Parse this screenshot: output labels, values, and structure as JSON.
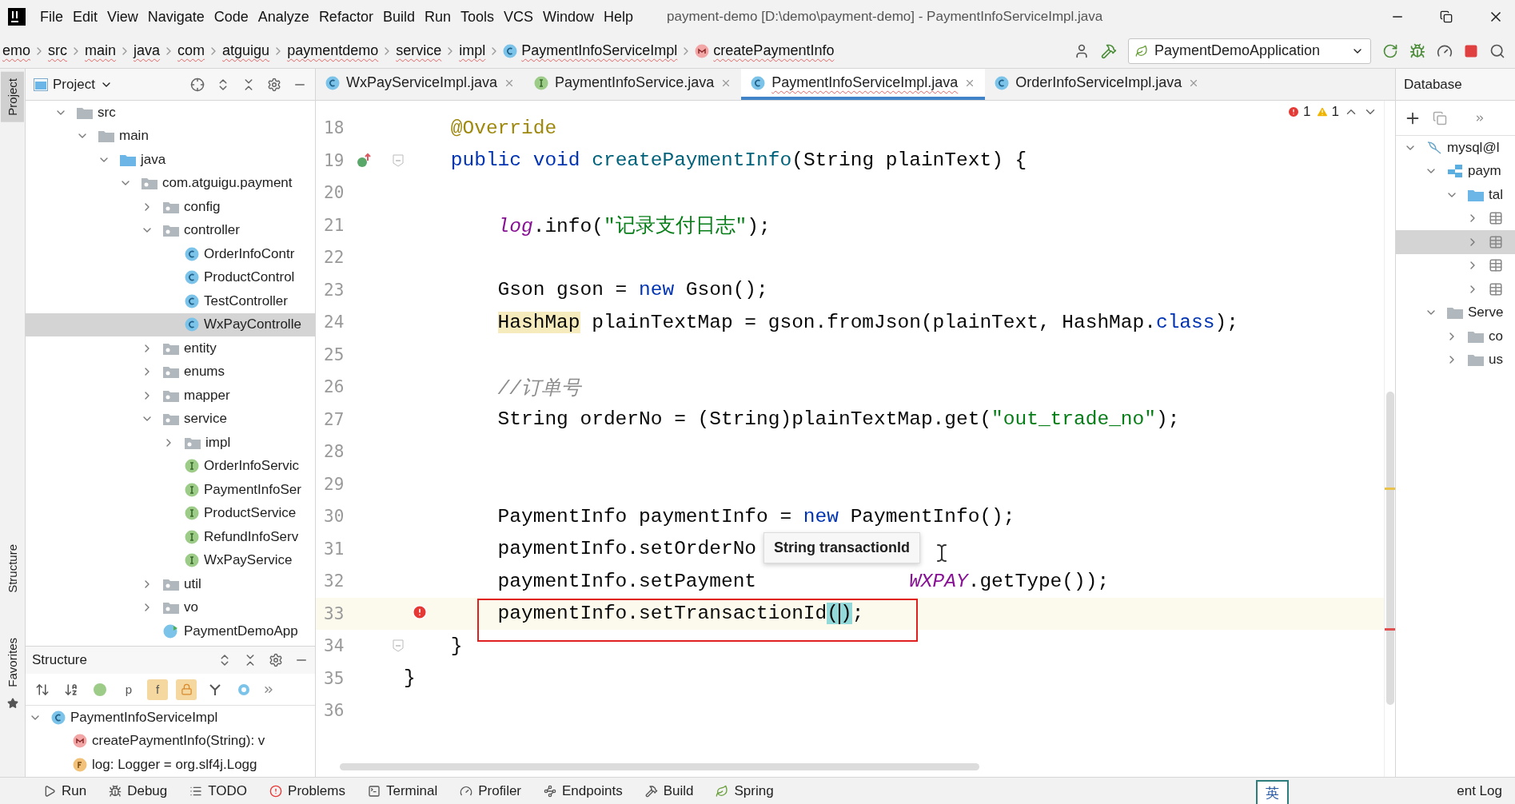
{
  "menu_bar": {
    "items": [
      "File",
      "Edit",
      "View",
      "Navigate",
      "Code",
      "Analyze",
      "Refactor",
      "Build",
      "Run",
      "Tools",
      "VCS",
      "Window",
      "Help"
    ],
    "title": "payment-demo [D:\\demo\\payment-demo] - PaymentInfoServiceImpl.java"
  },
  "navigation_bar": {
    "breadcrumbs": [
      {
        "label": "emo",
        "kind": "text"
      },
      {
        "label": "src",
        "kind": "text"
      },
      {
        "label": "main",
        "kind": "text"
      },
      {
        "label": "java",
        "kind": "text"
      },
      {
        "label": "com",
        "kind": "text"
      },
      {
        "label": "atguigu",
        "kind": "text"
      },
      {
        "label": "paymentdemo",
        "kind": "text"
      },
      {
        "label": "service",
        "kind": "text"
      },
      {
        "label": "impl",
        "kind": "text"
      },
      {
        "label": "PaymentInfoServiceImpl",
        "kind": "class"
      },
      {
        "label": "createPaymentInfo",
        "kind": "method"
      }
    ],
    "run_configuration": "PaymentDemoApplication"
  },
  "side_stripe": [
    {
      "label": "Project",
      "selected": true
    },
    {
      "label": "Structure",
      "selected": false
    },
    {
      "label": "Favorites",
      "selected": false
    }
  ],
  "project_panel": {
    "title": "Project",
    "tree": [
      {
        "label": "src",
        "kind": "folder",
        "expanded": true,
        "selected": false,
        "children": [
          {
            "label": "main",
            "kind": "folder",
            "expanded": true,
            "selected": false,
            "children": [
              {
                "label": "java",
                "kind": "source",
                "expanded": true,
                "selected": false,
                "children": [
                  {
                    "label": "com.atguigu.payment",
                    "kind": "package",
                    "expanded": true,
                    "selected": false,
                    "children": [
                      {
                        "label": "config",
                        "kind": "package",
                        "expanded": false,
                        "selected": false
                      },
                      {
                        "label": "controller",
                        "kind": "package",
                        "expanded": true,
                        "selected": false,
                        "children": [
                          {
                            "label": "OrderInfoContr",
                            "kind": "class",
                            "selected": false
                          },
                          {
                            "label": "ProductControl",
                            "kind": "class",
                            "selected": false
                          },
                          {
                            "label": "TestController",
                            "kind": "class",
                            "selected": false
                          },
                          {
                            "label": "WxPayControlle",
                            "kind": "class",
                            "selected": true
                          }
                        ]
                      },
                      {
                        "label": "entity",
                        "kind": "package",
                        "expanded": false,
                        "selected": false
                      },
                      {
                        "label": "enums",
                        "kind": "package",
                        "expanded": false,
                        "selected": false
                      },
                      {
                        "label": "mapper",
                        "kind": "package",
                        "expanded": false,
                        "selected": false
                      },
                      {
                        "label": "service",
                        "kind": "package",
                        "expanded": true,
                        "selected": false,
                        "children": [
                          {
                            "label": "impl",
                            "kind": "package",
                            "expanded": false,
                            "selected": false
                          },
                          {
                            "label": "OrderInfoServic",
                            "kind": "interface",
                            "selected": false
                          },
                          {
                            "label": "PaymentInfoSer",
                            "kind": "interface",
                            "selected": false
                          },
                          {
                            "label": "ProductService",
                            "kind": "interface",
                            "selected": false
                          },
                          {
                            "label": "RefundInfoServ",
                            "kind": "interface",
                            "selected": false
                          },
                          {
                            "label": "WxPayService",
                            "kind": "interface",
                            "selected": false
                          }
                        ]
                      },
                      {
                        "label": "util",
                        "kind": "package",
                        "expanded": false,
                        "selected": false
                      },
                      {
                        "label": "vo",
                        "kind": "package",
                        "expanded": false,
                        "selected": false
                      },
                      {
                        "label": "PaymentDemoApp",
                        "kind": "app",
                        "selected": false
                      }
                    ]
                  }
                ]
              }
            ]
          }
        ]
      }
    ]
  },
  "editor_tabs": [
    {
      "label": "WxPayServiceImpl.java",
      "kind": "class",
      "selected": false
    },
    {
      "label": "PaymentInfoService.java",
      "kind": "interface",
      "selected": false
    },
    {
      "label": "PaymentInfoServiceImpl.java",
      "kind": "class",
      "selected": true
    },
    {
      "label": "OrderInfoServiceImpl.java",
      "kind": "class",
      "selected": false
    }
  ],
  "editor": {
    "inspections": {
      "errors": "1",
      "warnings": "1"
    },
    "tooltip": "String transactionId",
    "blocks": [
      {
        "kind": "member",
        "lines": [
          {
            "number": "18",
            "kind": "plain",
            "fold": false,
            "current": false,
            "segments": [
              {
                "kind": "annotation",
                "text": "@Override"
              }
            ]
          },
          {
            "number": "19",
            "kind": "override",
            "fold": true,
            "current": false,
            "segments": [
              {
                "kind": "keyword",
                "text": "public void "
              },
              {
                "kind": "method",
                "text": "createPaymentInfo"
              },
              {
                "kind": "plain",
                "text": "(String plainText) {"
              }
            ]
          }
        ]
      },
      {
        "kind": "body",
        "lines": [
          {
            "number": "20",
            "kind": "plain",
            "fold": false,
            "current": false
          },
          {
            "number": "21",
            "kind": "plain",
            "fold": false,
            "current": false,
            "segments": [
              {
                "kind": "field",
                "text": "log"
              },
              {
                "kind": "plain",
                "text": ".info("
              },
              {
                "kind": "string",
                "text": "\"记录支付日志\""
              },
              {
                "kind": "plain",
                "text": ");"
              }
            ]
          },
          {
            "number": "22",
            "kind": "plain",
            "fold": false,
            "current": false
          },
          {
            "number": "23",
            "kind": "plain",
            "fold": false,
            "current": false,
            "segments": [
              {
                "kind": "plain",
                "text": "Gson gson = "
              },
              {
                "kind": "keyword",
                "text": "new"
              },
              {
                "kind": "plain",
                "text": " Gson();"
              }
            ]
          },
          {
            "number": "24",
            "kind": "plain",
            "fold": false,
            "current": false,
            "segments": [
              {
                "kind": "warning",
                "text": "HashMap"
              },
              {
                "kind": "plain",
                "text": " plainTextMap = gson.fromJson(plainText, HashMap."
              },
              {
                "kind": "keyword",
                "text": "class"
              },
              {
                "kind": "plain",
                "text": ");"
              }
            ]
          },
          {
            "number": "25",
            "kind": "plain",
            "fold": false,
            "current": false
          },
          {
            "number": "26",
            "kind": "plain",
            "fold": false,
            "current": false,
            "segments": [
              {
                "kind": "comment",
                "text": "//订单号"
              }
            ]
          },
          {
            "number": "27",
            "kind": "plain",
            "fold": false,
            "current": false,
            "segments": [
              {
                "kind": "plain",
                "text": "String orderNo = (String)plainTextMap.get("
              },
              {
                "kind": "string",
                "text": "\"out_trade_no\""
              },
              {
                "kind": "plain",
                "text": ");"
              }
            ]
          },
          {
            "number": "28",
            "kind": "plain",
            "fold": false,
            "current": false
          },
          {
            "number": "29",
            "kind": "plain",
            "fold": false,
            "current": false
          },
          {
            "number": "30",
            "kind": "plain",
            "fold": false,
            "current": false,
            "segments": [
              {
                "kind": "plain",
                "text": "PaymentInfo paymentInfo = "
              },
              {
                "kind": "keyword",
                "text": "new"
              },
              {
                "kind": "plain",
                "text": " PaymentInfo();"
              }
            ]
          },
          {
            "number": "31",
            "kind": "plain",
            "fold": false,
            "current": false,
            "segments": [
              {
                "kind": "plain",
                "text": "paymentInfo.setOrderNo"
              }
            ]
          },
          {
            "number": "32",
            "kind": "plain",
            "fold": false,
            "current": false,
            "segments": [
              {
                "kind": "plain",
                "text": "paymentInfo.setPayment"
              },
              {
                "kind": "covered"
              },
              {
                "kind": "field",
                "text": "WXPAY"
              },
              {
                "kind": "plain",
                "text": ".getType());"
              }
            ]
          },
          {
            "number": "33",
            "kind": "error",
            "fold": false,
            "current": true,
            "segments": [
              {
                "kind": "plain",
                "text": "paymentInfo.setTransactionId"
              },
              {
                "kind": "brace",
                "text": "("
              },
              {
                "kind": "caret"
              },
              {
                "kind": "brace",
                "text": ")"
              },
              {
                "kind": "plain",
                "text": ";"
              }
            ]
          }
        ]
      },
      {
        "kind": "member",
        "lines": [
          {
            "number": "34",
            "kind": "plain",
            "fold": true,
            "current": false,
            "segments": [
              {
                "kind": "plain",
                "text": "}"
              }
            ]
          }
        ]
      },
      {
        "kind": "top",
        "lines": [
          {
            "number": "35",
            "kind": "plain",
            "fold": false,
            "current": false,
            "segments": [
              {
                "kind": "plain",
                "text": "}"
              }
            ]
          },
          {
            "number": "36",
            "kind": "plain",
            "fold": false,
            "current": false
          }
        ]
      }
    ]
  },
  "structure_panel": {
    "title": "Structure",
    "filters": [
      {
        "kind": "sort",
        "selected": false
      },
      {
        "kind": "sort-alpha",
        "selected": false
      },
      {
        "kind": "inherited",
        "selected": false
      },
      {
        "kind": "glyph",
        "glyph": "p",
        "selected": false
      },
      {
        "kind": "glyph",
        "glyph": "f",
        "selected": true
      },
      {
        "kind": "lock",
        "selected": true
      },
      {
        "kind": "anonymous",
        "selected": false
      },
      {
        "kind": "lambda",
        "selected": false
      }
    ],
    "tree": [
      {
        "label": "PaymentInfoServiceImpl",
        "kind": "class",
        "expanded": true,
        "selected": false,
        "children": [
          {
            "label": "createPaymentInfo(String): v",
            "kind": "method",
            "selected": false
          },
          {
            "label": "log: Logger = org.slf4j.Logg",
            "kind": "field",
            "selected": false
          }
        ]
      }
    ]
  },
  "database_panel": {
    "title": "Database",
    "tree": [
      {
        "label": "mysql@l",
        "kind": "connection",
        "expanded": true,
        "selected": false,
        "children": [
          {
            "label": "paym",
            "kind": "schema",
            "expanded": true,
            "selected": false,
            "children": [
              {
                "label": "tal",
                "kind": "source",
                "expanded": true,
                "selected": false,
                "children": [
                  {
                    "kind": "table",
                    "expanded": false,
                    "selected": false
                  },
                  {
                    "kind": "table",
                    "expanded": false,
                    "selected": true
                  },
                  {
                    "kind": "table",
                    "expanded": false,
                    "selected": false
                  },
                  {
                    "kind": "table",
                    "expanded": false,
                    "selected": false
                  }
                ]
              }
            ]
          },
          {
            "label": "Serve",
            "kind": "folder",
            "expanded": true,
            "selected": false,
            "children": [
              {
                "label": "co",
                "kind": "folder",
                "expanded": false,
                "selected": false
              },
              {
                "label": "us",
                "kind": "folder",
                "expanded": false,
                "selected": false
              }
            ]
          }
        ]
      }
    ]
  },
  "tool_window_bar": {
    "items": [
      {
        "label": "Run",
        "kind": "run"
      },
      {
        "label": "Debug",
        "kind": "debug"
      },
      {
        "label": "TODO",
        "kind": "todo"
      },
      {
        "label": "Problems",
        "kind": "problems"
      },
      {
        "label": "Terminal",
        "kind": "terminal"
      },
      {
        "label": "Profiler",
        "kind": "profiler"
      },
      {
        "label": "Endpoints",
        "kind": "endpoints"
      },
      {
        "label": "Build",
        "kind": "build"
      },
      {
        "label": "Spring",
        "kind": "spring"
      }
    ],
    "event_log": "ent Log"
  },
  "input_method": "英"
}
